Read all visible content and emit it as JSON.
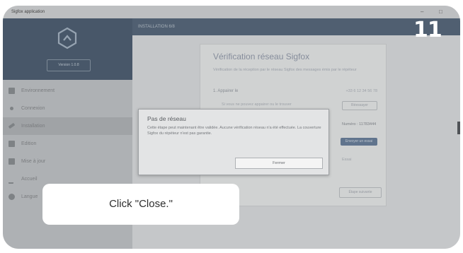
{
  "window": {
    "title": "Sigfox application",
    "minimize_glyph": "–",
    "maximize_glyph": "□"
  },
  "sidebar": {
    "version_label": "Version 1.0.8",
    "items": [
      {
        "label": "Environnement",
        "icon": "environment-icon"
      },
      {
        "label": "Connexion",
        "icon": "connection-icon"
      },
      {
        "label": "Installation",
        "icon": "installation-icon"
      },
      {
        "label": "Edition",
        "icon": "edit-icon"
      },
      {
        "label": "Mise à jour",
        "icon": "update-icon"
      },
      {
        "label": "Accueil",
        "icon": "home-icon"
      },
      {
        "label": "Langue",
        "icon": "language-icon"
      }
    ]
  },
  "header": {
    "breadcrumb": "INSTALLATION 6/8"
  },
  "card": {
    "title": "Vérification réseau Sigfox",
    "description": "Vérification de la réception par le réseau Sigfox des messages émis par le répéteur",
    "step_label": "1. Appairer le",
    "step_value": "+33 6 12 34 56 78",
    "hint_text": "Si vous ne pouvez appairer ou le trouver",
    "retry_label": "Réessayer",
    "number_label": "Numéro : 11783444",
    "send_label": "Envoyer un essai",
    "other_text": "Essai",
    "next_label": "Étape suivante"
  },
  "dialog": {
    "title": "Pas de réseau",
    "body": "Cette étape peut maintenant être validée. Aucune vérification réseau n'a été effectuée. La couverture Sigfox du répéteur n'est pas garantie.",
    "close_label": "Fermer"
  },
  "overlay": {
    "step_number": "11",
    "instruction": "Click \"Close.\""
  },
  "colors": {
    "sidebar_header": "#415367",
    "main_bar": "#4a5c70",
    "accent_button": "#5d7390"
  }
}
